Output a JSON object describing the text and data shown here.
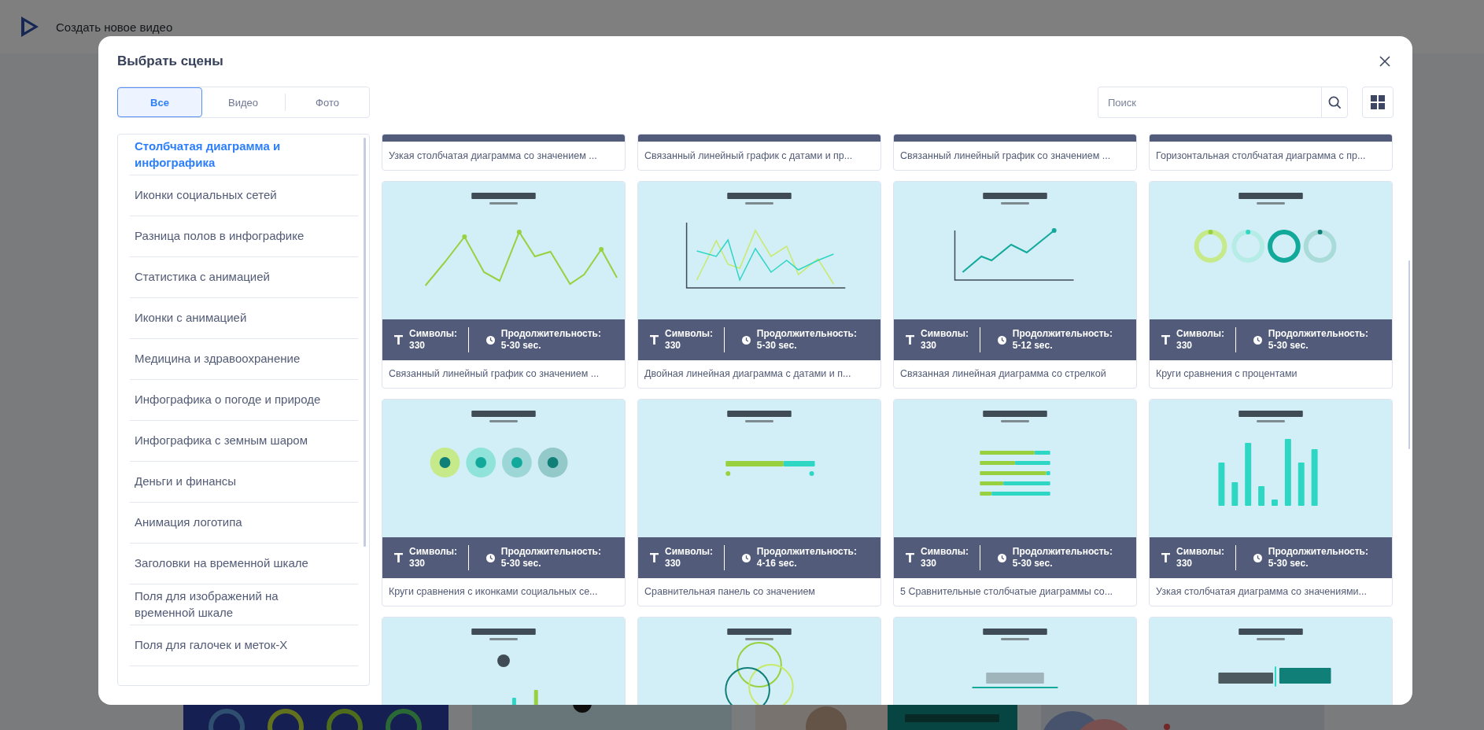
{
  "page": {
    "title": "Создать новое видео"
  },
  "dialog": {
    "title": "Выбрать сцены",
    "tabs": [
      {
        "label": "Все",
        "selected": true
      },
      {
        "label": "Видео",
        "selected": false
      },
      {
        "label": "Фото",
        "selected": false
      }
    ],
    "search": {
      "placeholder": "Поиск"
    },
    "categories": [
      {
        "label": "Столбчатая диаграмма и инфографика",
        "selected": true
      },
      {
        "label": "Иконки социальных сетей",
        "selected": false
      },
      {
        "label": "Разница полов в инфографике",
        "selected": false
      },
      {
        "label": "Статистика с анимацией",
        "selected": false
      },
      {
        "label": "Иконки с анимацией",
        "selected": false
      },
      {
        "label": "Медицина и здравоохранение",
        "selected": false
      },
      {
        "label": "Инфографика о погоде и природе",
        "selected": false
      },
      {
        "label": "Инфографика с земным шаром",
        "selected": false
      },
      {
        "label": "Деньги и финансы",
        "selected": false
      },
      {
        "label": "Анимация логотипа",
        "selected": false
      },
      {
        "label": "Заголовки на временной шкале",
        "selected": false
      },
      {
        "label": "Поля для изображений на временной шкале",
        "selected": false
      },
      {
        "label": "Поля для галочек и меток-X",
        "selected": false
      }
    ],
    "scenes": [
      {
        "kind": "label-only",
        "title": "Узкая столбчатая диаграмма со значением ..."
      },
      {
        "kind": "label-only",
        "title": "Связанный линейный график с датами и пр..."
      },
      {
        "kind": "label-only",
        "title": "Связанный линейный график со значением ..."
      },
      {
        "kind": "label-only",
        "title": "Горизонтальная столбчатая диаграмма с пр..."
      },
      {
        "kind": "full",
        "symbols_label": "Символы:",
        "symbols": "330",
        "duration_label": "Продолжительность:",
        "duration": "5-30 sec.",
        "title": "Связанный линейный график со значением ..."
      },
      {
        "kind": "full",
        "symbols_label": "Символы:",
        "symbols": "330",
        "duration_label": "Продолжительность:",
        "duration": "5-30 sec.",
        "title": "Двойная линейная диаграмма с датами и п..."
      },
      {
        "kind": "full",
        "symbols_label": "Символы:",
        "symbols": "330",
        "duration_label": "Продолжительность:",
        "duration": "5-12 sec.",
        "title": "Связанная линейная диаграмма со стрелкой"
      },
      {
        "kind": "full",
        "symbols_label": "Символы:",
        "symbols": "330",
        "duration_label": "Продолжительность:",
        "duration": "5-30 sec.",
        "title": "Круги сравнения с процентами"
      },
      {
        "kind": "full",
        "symbols_label": "Символы:",
        "symbols": "330",
        "duration_label": "Продолжительность:",
        "duration": "5-30 sec.",
        "title": "Круги сравнения с иконками социальных се..."
      },
      {
        "kind": "full",
        "symbols_label": "Символы:",
        "symbols": "330",
        "duration_label": "Продолжительность:",
        "duration": "4-16 sec.",
        "title": "Сравнительная панель со значением"
      },
      {
        "kind": "full",
        "symbols_label": "Символы:",
        "symbols": "330",
        "duration_label": "Продолжительность:",
        "duration": "5-30 sec.",
        "title": "5 Сравнительные столбчатые диаграммы со..."
      },
      {
        "kind": "full",
        "symbols_label": "Символы:",
        "symbols": "330",
        "duration_label": "Продолжительность:",
        "duration": "5-30 sec.",
        "title": "Узкая столбчатая диаграмма со значениями..."
      },
      {
        "kind": "image-only"
      },
      {
        "kind": "image-only"
      },
      {
        "kind": "image-only"
      },
      {
        "kind": "image-only"
      }
    ]
  }
}
